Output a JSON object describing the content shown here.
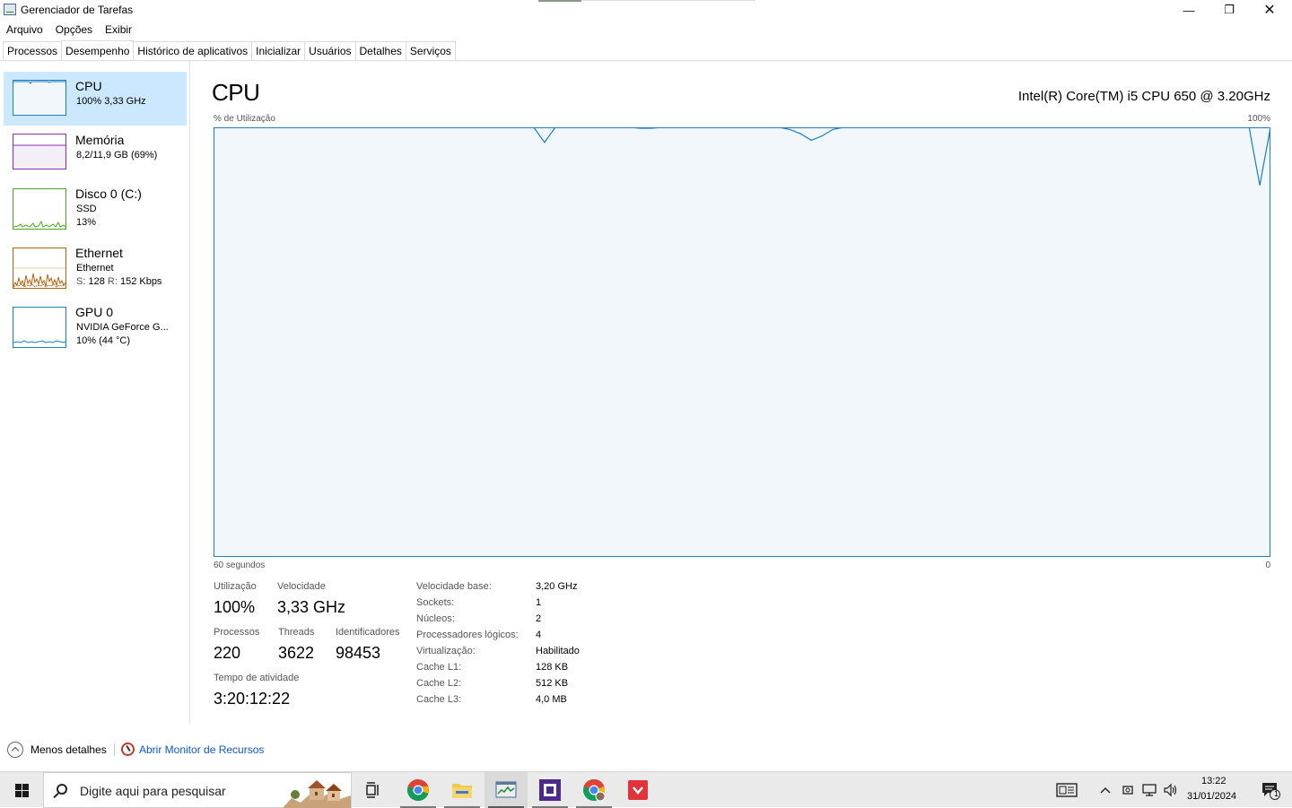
{
  "window": {
    "title": "Gerenciador de Tarefas",
    "controls": {
      "minimize": "—",
      "maximize": "❐",
      "close": "✕"
    }
  },
  "menu": [
    "Arquivo",
    "Opções",
    "Exibir"
  ],
  "tabs": [
    {
      "label": "Processos",
      "active": false
    },
    {
      "label": "Desempenho",
      "active": true
    },
    {
      "label": "Histórico de aplicativos",
      "active": false
    },
    {
      "label": "Inicializar",
      "active": false
    },
    {
      "label": "Usuários",
      "active": false
    },
    {
      "label": "Detalhes",
      "active": false
    },
    {
      "label": "Serviços",
      "active": false
    }
  ],
  "sidebar": {
    "items": [
      {
        "name": "CPU",
        "line1": "100% 3,33 GHz",
        "line2": "",
        "selected": true,
        "color": "#1a7fc1"
      },
      {
        "name": "Memória",
        "line1": "8,2/11,9 GB (69%)",
        "line2": "",
        "selected": false,
        "color": "#8b2fb0"
      },
      {
        "name": "Disco 0 (C:)",
        "line1": "SSD",
        "line2": "13%",
        "selected": false,
        "color": "#4caa1e"
      },
      {
        "name": "Ethernet",
        "line1": "Ethernet",
        "line2_s_label": "S:",
        "line2_s_value": "128",
        "line2_r_label": "R:",
        "line2_r_value": "152 Kbps",
        "selected": false,
        "color": "#b5620f"
      },
      {
        "name": "GPU 0",
        "line1": "NVIDIA GeForce G...",
        "line2": "10% (44 °C)",
        "selected": false,
        "color": "#1a7fc1"
      }
    ]
  },
  "main": {
    "title": "CPU",
    "model": "Intel(R) Core(TM) i5 CPU 650 @ 3.20GHz",
    "graph_label": "% de Utilização",
    "graph_max": "100%",
    "graph_time": "60 segundos",
    "graph_min": "0",
    "stats": {
      "utilization_label": "Utilização",
      "utilization": "100%",
      "speed_label": "Velocidade",
      "speed": "3,33 GHz",
      "processes_label": "Processos",
      "processes": "220",
      "threads_label": "Threads",
      "threads": "3622",
      "handles_label": "Identificadores",
      "handles": "98453",
      "uptime_label": "Tempo de atividade",
      "uptime": "3:20:12:22"
    },
    "details": [
      {
        "key": "Velocidade base:",
        "value": "3,20 GHz"
      },
      {
        "key": "Sockets:",
        "value": "1"
      },
      {
        "key": "Núcleos:",
        "value": "2"
      },
      {
        "key": "Processadores lógicos:",
        "value": "4"
      },
      {
        "key": "Virtualização:",
        "value": "Habilitado"
      },
      {
        "key": "Cache L1:",
        "value": "128 KB"
      },
      {
        "key": "Cache L2:",
        "value": "512 KB"
      },
      {
        "key": "Cache L3:",
        "value": "4,0 MB"
      }
    ]
  },
  "footer": {
    "less_details": "Menos detalhes",
    "open_resource_monitor": "Abrir Monitor de Recursos"
  },
  "taskbar": {
    "search_placeholder": "Digite aqui para pesquisar",
    "apps": [
      "task-view-icon",
      "chrome-icon",
      "file-explorer-icon",
      "task-manager-icon",
      "cpu-z-icon",
      "chrome-profile-icon",
      "vivaldi-icon"
    ],
    "time": "13:22",
    "date": "31/01/2024",
    "notification_count": "1"
  },
  "chart_data": {
    "type": "line",
    "ylim": [
      0,
      100
    ],
    "xlabel": "60 segundos",
    "ylabel": "% de Utilização",
    "series": [
      {
        "values": [
          100,
          100,
          100,
          100,
          100,
          100,
          100,
          100,
          100,
          100,
          100,
          100,
          100,
          100,
          100,
          100,
          100,
          100,
          100,
          100,
          100,
          100,
          100,
          100,
          100,
          100,
          100,
          100,
          100,
          100,
          100,
          96.5,
          100,
          100,
          100,
          100,
          100,
          100,
          100,
          100,
          99.8,
          99.8,
          100,
          100,
          100,
          100,
          100,
          100,
          100,
          100,
          100,
          100,
          100,
          100,
          99.5,
          98.5,
          97,
          98,
          99.5,
          100,
          100,
          100,
          100,
          100,
          100,
          100,
          100,
          100,
          100,
          100,
          100,
          100,
          100,
          100,
          100,
          100,
          100,
          100,
          100,
          100,
          100,
          100,
          100,
          100,
          100,
          100,
          100,
          100,
          100,
          100,
          100,
          100,
          100,
          100,
          100,
          100,
          100,
          100,
          86.5,
          100
        ]
      }
    ]
  }
}
